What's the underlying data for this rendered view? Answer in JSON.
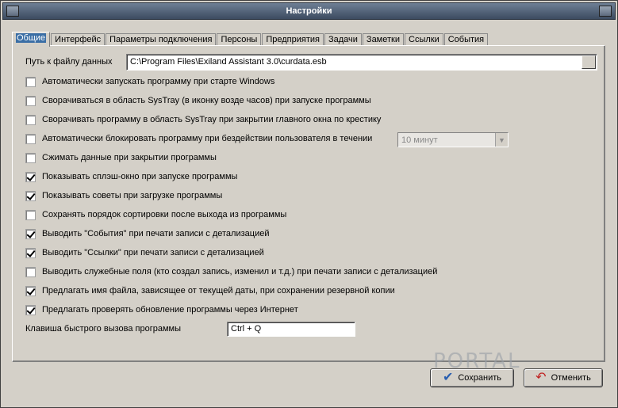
{
  "window": {
    "title": "Настройки"
  },
  "tabs": [
    {
      "label": "Общие",
      "active": true
    },
    {
      "label": "Интерфейс"
    },
    {
      "label": "Параметры подключения"
    },
    {
      "label": "Персоны"
    },
    {
      "label": "Предприятия"
    },
    {
      "label": "Задачи"
    },
    {
      "label": "Заметки"
    },
    {
      "label": "Ссылки"
    },
    {
      "label": "События"
    }
  ],
  "data_path": {
    "label": "Путь к файлу данных",
    "value": "C:\\Program Files\\Exiland Assistant 3.0\\curdata.esb"
  },
  "options": [
    {
      "label": "Автоматически запускать программу при старте Windows",
      "checked": false
    },
    {
      "label": "Сворачиваться в область SysTray (в иконку возде часов) при запуске программы",
      "checked": false
    },
    {
      "label": "Сворачивать программу в область SysTray при закрытии главного окна по крестику",
      "checked": false
    },
    {
      "label": "Автоматически блокировать программу при бездействии пользователя в течении",
      "checked": false
    },
    {
      "label": "Сжимать данные при закрытии программы",
      "checked": false
    },
    {
      "label": "Показывать сплэш-окно при запуске программы",
      "checked": true
    },
    {
      "label": "Показывать советы при загрузке программы",
      "checked": true
    },
    {
      "label": "Сохранять порядок сортировки после выхода из программы",
      "checked": false
    },
    {
      "label": "Выводить \"События\" при печати записи с детализацией",
      "checked": true
    },
    {
      "label": "Выводить \"Ссылки\" при печати записи с детализацией",
      "checked": true
    },
    {
      "label": "Выводить служебные поля (кто создал запись, изменил и т.д.) при печати записи с детализацией",
      "checked": false
    },
    {
      "label": "Предлагать имя файла, зависящее от текущей даты, при сохранении резервной копии",
      "checked": true
    },
    {
      "label": "Предлагать проверять обновление программы через Интернет",
      "checked": true
    }
  ],
  "lock_timeout": {
    "value": "10 минут"
  },
  "hotkey": {
    "label": "Клавиша быстрого вызова программы",
    "value": "Ctrl + Q"
  },
  "buttons": {
    "save": "Сохранить",
    "cancel": "Отменить"
  },
  "watermark": "PORTAL",
  "colors": {
    "title_bar": "#4a5a70",
    "active_tab": "#3a6ea5",
    "window_bg": "#d4d0c8"
  }
}
